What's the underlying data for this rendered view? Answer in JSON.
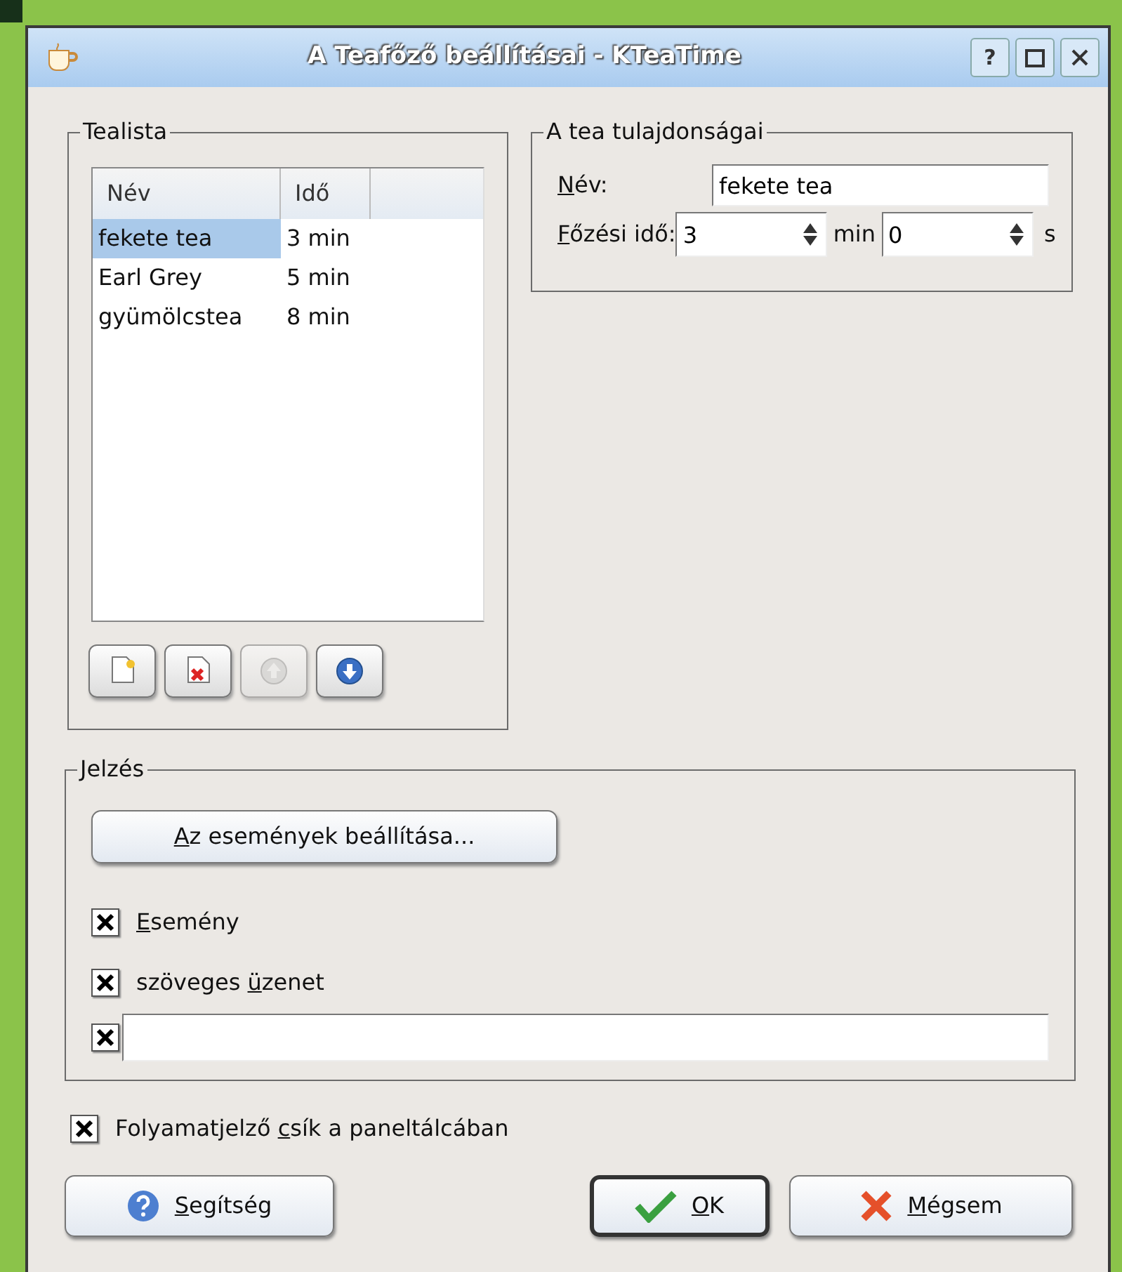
{
  "window": {
    "title": "A Teafőző beállításai - KTeaTime"
  },
  "title_buttons": [
    {
      "kind": "help",
      "label": "?"
    },
    {
      "kind": "maximize"
    },
    {
      "kind": "close"
    }
  ],
  "tealist": {
    "title": "Tealista",
    "columns": [
      "Név",
      "Idő"
    ],
    "rows": [
      {
        "name": "fekete tea",
        "time": "3 min",
        "selected": true
      },
      {
        "name": "Earl Grey",
        "time": "5 min",
        "selected": false
      },
      {
        "name": "gyümölcstea",
        "time": "8 min",
        "selected": false
      }
    ],
    "tools": [
      {
        "kind": "new",
        "disabled": false
      },
      {
        "kind": "delete",
        "disabled": false
      },
      {
        "kind": "up",
        "disabled": true
      },
      {
        "kind": "down",
        "disabled": false
      }
    ]
  },
  "properties": {
    "title": "A tea tulajdonságai",
    "name_label": {
      "key": "N",
      "post": "év:"
    },
    "name_value": "fekete tea",
    "time_label": {
      "key": "F",
      "post": "őzési idő:"
    },
    "minutes": "3",
    "minutes_unit": "min",
    "seconds": "0",
    "seconds_unit": "s"
  },
  "notification": {
    "title": "Jelzés",
    "configure_button": {
      "key": "A",
      "post": "z események beállítása..."
    },
    "options": [
      {
        "kind": "check",
        "checked": true,
        "label": {
          "key": "E",
          "post": "semény"
        }
      },
      {
        "kind": "check",
        "checked": true,
        "label": {
          "pre": "szöveges ",
          "key": "ü",
          "post": "zenet"
        }
      },
      {
        "kind": "field",
        "checked": true
      }
    ]
  },
  "progress_option": {
    "checked": true,
    "label": {
      "pre": "Folyamatjelző ",
      "key": "c",
      "post": "sík a paneltálcában"
    }
  },
  "buttons": [
    {
      "kind": "help",
      "default": false,
      "label": {
        "key": "S",
        "post": "egítség"
      }
    },
    {
      "kind": "ok",
      "default": true,
      "label": {
        "key": "O",
        "post": "K"
      }
    },
    {
      "kind": "cancel",
      "default": false,
      "label": {
        "key": "M",
        "post": "égsem"
      }
    }
  ]
}
